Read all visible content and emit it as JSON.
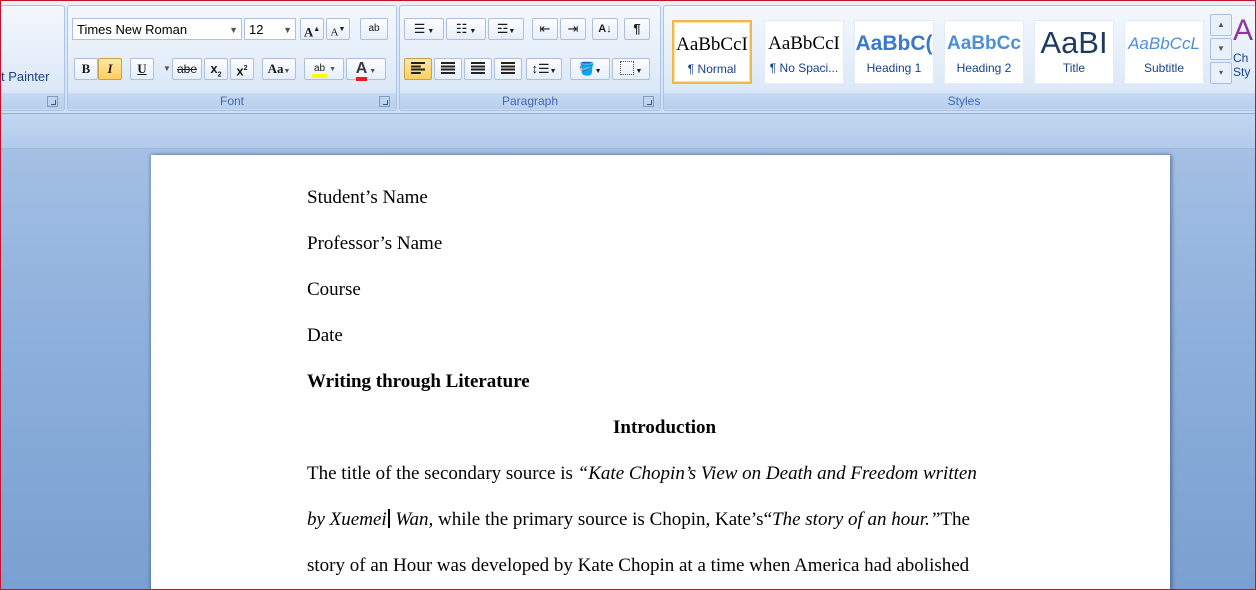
{
  "clipboard": {
    "format_painter_label": "t Painter"
  },
  "font": {
    "group_label": "Font",
    "font_name": "Times New Roman",
    "font_size": "12",
    "grow_label": "A",
    "shrink_label": "A",
    "clear_label": "ab",
    "bold_label": "B",
    "italic_label": "I",
    "underline_label": "U",
    "strike_label": "abe",
    "subscript_label": "x",
    "superscript_label": "x",
    "case_label": "Aa",
    "highlight_label": "ab",
    "font_color_label": "A"
  },
  "paragraph": {
    "group_label": "Paragraph",
    "show_marks_label": "¶",
    "sort_label": "A↓"
  },
  "styles": {
    "group_label": "Styles",
    "items": [
      {
        "sample": "AaBbCcI",
        "name": "¶ Normal"
      },
      {
        "sample": "AaBbCcI",
        "name": "¶ No Spaci..."
      },
      {
        "sample": "AaBbC(",
        "name": "Heading 1"
      },
      {
        "sample": "AaBbCc",
        "name": "Heading 2"
      },
      {
        "sample": "AaBI",
        "name": "Title"
      },
      {
        "sample": "AaBbCcL",
        "name": "Subtitle"
      }
    ],
    "change_styles_label": "Ch",
    "change_styles_label2": "Sty"
  },
  "document": {
    "student": "Student’s Name",
    "professor": "Professor’s Name",
    "course": "Course",
    "date": "Date",
    "title": "Writing through Literature",
    "heading": "Introduction",
    "p1_a": "The title of the secondary source is ",
    "p1_b": "“Kate Chopin’s View on Death and Freedom written",
    "p2_a": "by Xuemei",
    "p2_b": " Wan,",
    "p2_c": " while the primary source is Chopin, Kate’s“",
    "p2_d": "The story of an hour.”",
    "p2_e": "The",
    "p3": "story of an Hour was developed by Kate Chopin at a time when America had abolished"
  }
}
